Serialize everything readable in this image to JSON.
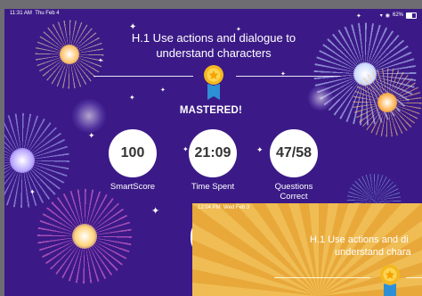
{
  "status_bar": {
    "time": "11:31 AM",
    "date": "Thu Feb 4",
    "battery": "62%"
  },
  "skill": {
    "title_line1": "H.1 Use actions and dialogue to",
    "title_line2": "understand characters"
  },
  "badge": {
    "label": "MASTERED!"
  },
  "stats": [
    {
      "value": "100",
      "label": "SmartScore"
    },
    {
      "value": "21:09",
      "label": "Time Spent"
    },
    {
      "value": "47/58",
      "label": "Questions",
      "label2": "Correct"
    }
  ],
  "second_screen": {
    "status_time": "12:04 PM",
    "status_date": "Wed Feb 3",
    "title_line1": "H.1 Use actions and di",
    "title_line2": "understand chara"
  },
  "colors": {
    "bg": "#3b1a87",
    "second_bg": "#eeb347",
    "medal": "#f4b81e",
    "ribbon": "#2d8fd6"
  }
}
